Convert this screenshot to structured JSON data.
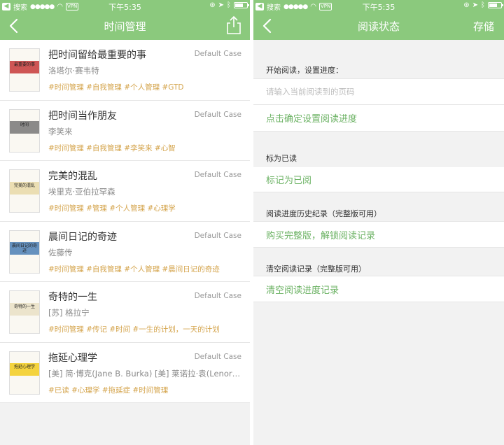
{
  "status_bar": {
    "back_app": "搜索",
    "vpn": "VPN",
    "time": "下午5:35"
  },
  "left": {
    "title": "时间管理",
    "books": [
      {
        "title": "把时间留给最重要的事",
        "case": "Default Case",
        "author": "洛塔尔·赛韦特",
        "tags": "#时间管理  #自我管理  #个人管理  #GTD",
        "cover_accent": "#c63a3a",
        "cover_text": "最重要的事"
      },
      {
        "title": "把时间当作朋友",
        "case": "Default Case",
        "author": "李笑来",
        "tags": "#时间管理  #自我管理  #李笑来  #心智",
        "cover_accent": "#777777",
        "cover_text": "时间"
      },
      {
        "title": "完美的混乱",
        "case": "Default Case",
        "author": "埃里克·亚伯拉罕森",
        "tags": "#时间管理  #管理  #个人管理  #心理学",
        "cover_accent": "#e8d9a8",
        "cover_text": "完美的混乱"
      },
      {
        "title": "晨间日记的奇迹",
        "case": "Default Case",
        "author": "佐藤传",
        "tags": "#时间管理  #自我管理  #个人管理  #晨间日记的奇迹",
        "cover_accent": "#4a7fb5",
        "cover_text": "晨间日记的奇迹"
      },
      {
        "title": "奇特的一生",
        "case": "Default Case",
        "author": "[苏] 格拉宁",
        "tags": "#时间管理  #传记  #时间  #一生的计划，一天的计划",
        "cover_accent": "#e9e1c6",
        "cover_text": "奇特的一生"
      },
      {
        "title": "拖延心理学",
        "case": "Default Case",
        "author": "[美] 简·博克(Jane B. Burka) [美] 莱诺拉·袁(Lenora M. Yuen)",
        "tags": "#已读  #心理学  #拖延症  #时间管理",
        "cover_accent": "#f2cc1f",
        "cover_text": "拖延心理学"
      }
    ]
  },
  "right": {
    "title": "阅读状态",
    "save_label": "存储",
    "start_label": "开始阅读，设置进度：",
    "page_placeholder": "请输入当前阅读到的页码",
    "confirm_progress": "点击确定设置阅读进度",
    "mark_read_label": "标为已读",
    "mark_read_action": "标记为已阅",
    "history_label": "阅读进度历史纪录（完整版可用）",
    "buy_action": "购买完整版，解锁阅读记录",
    "clear_label": "清空阅读记录（完整版可用）",
    "clear_action": "清空阅读进度记录"
  },
  "colors": {
    "nav_green": "#8bc97d",
    "action_green": "#6bb263",
    "tag_gold": "#d4a44c"
  }
}
